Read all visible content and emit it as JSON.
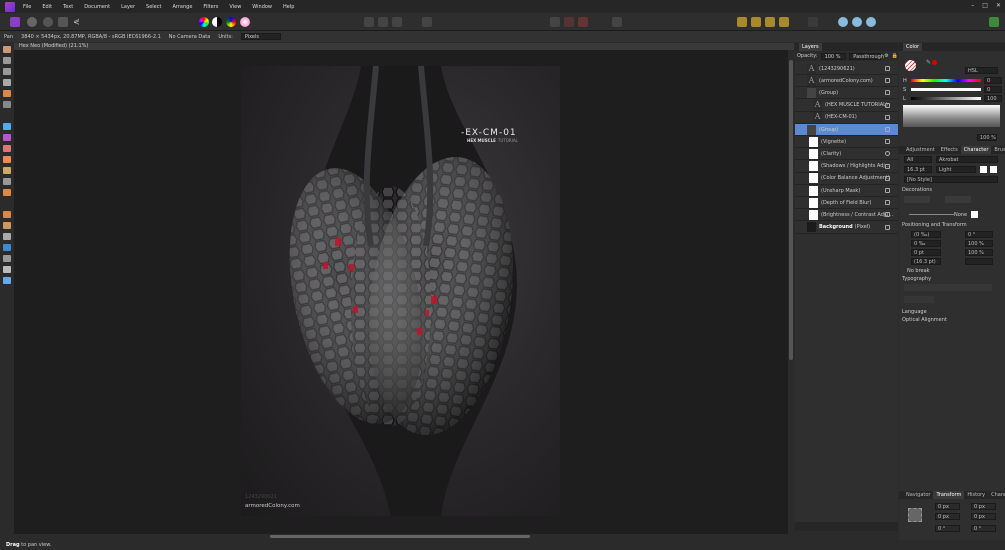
{
  "menu": [
    "File",
    "Edit",
    "Text",
    "Document",
    "Layer",
    "Select",
    "Arrange",
    "Filters",
    "View",
    "Window",
    "Help"
  ],
  "context": {
    "tool": "Pan",
    "info": "3840 × 5434px, 20.87MP, RGBA/8 - sRGB IEC61966-2.1",
    "camera": "No Camera Data",
    "units_label": "Units:",
    "units_value": "Pixels"
  },
  "document_tab": "Hex Neo (Modified) (21.1%)",
  "canvas": {
    "title_art": "-EX-CM-01",
    "subtitle": "HEX MUSCLE",
    "subtitle2": "TUTORIAL",
    "watermark_small": "1243290621",
    "watermark": "armoredColony.com"
  },
  "layers": {
    "tab": "Layers",
    "opacity_label": "Opacity:",
    "opacity": "100 %",
    "blend": "Passthrough",
    "items": [
      {
        "name": "(1243290621)",
        "type": "text"
      },
      {
        "name": "(armoredColony.com)",
        "type": "text"
      },
      {
        "name": "(Group)",
        "type": "group"
      },
      {
        "name": "(HEX MUSCLE TUTORIAL)",
        "type": "text"
      },
      {
        "name": "(HEX-CM-01)",
        "type": "text"
      },
      {
        "name": "(Group)",
        "type": "group",
        "selected": true
      },
      {
        "name": "(Vignette)",
        "type": "adj"
      },
      {
        "name": "(Clarity)",
        "type": "adj"
      },
      {
        "name": "(Shadows / Highlights Adj...",
        "type": "adj"
      },
      {
        "name": "(Color Balance Adjustment)",
        "type": "adj"
      },
      {
        "name": "(Unsharp Mask)",
        "type": "adj"
      },
      {
        "name": "(Depth of Field Blur)",
        "type": "adj"
      },
      {
        "name": "(Brightness / Contrast Adju...",
        "type": "adj"
      },
      {
        "name": "Background",
        "suffix": "(Pixel)",
        "type": "pixel"
      }
    ]
  },
  "color": {
    "tab": "Color",
    "model": "HSL",
    "h": "0",
    "s": "0",
    "l": "100",
    "h_label": "H",
    "s_label": "S",
    "l_label": "L",
    "opacity": "100 %",
    "accent": "#e00000"
  },
  "character": {
    "tabs": [
      "Adjustment",
      "Effects",
      "Character",
      "Brushes"
    ],
    "active": "Character",
    "scope": "All",
    "font": "Akrobat",
    "size": "16.3 pt",
    "weight": "Light",
    "style": "[No Style]",
    "decorations": "Decorations",
    "none_label": "None",
    "positioning": "Positioning and Transform",
    "kerning": "(0 ‰)",
    "tracking": "0 ‰",
    "baseline": "0 pt",
    "leading": "(16.3 pt)",
    "shear": "0 °",
    "hscale": "100 %",
    "vscale": "100 %",
    "no_break": "No break",
    "typography": "Typography",
    "language": "Language",
    "optical": "Optical Alignment"
  },
  "bottom": {
    "tabs": [
      "Navigator",
      "Transform",
      "History",
      "Channels"
    ],
    "active": "Transform",
    "x": "0 px",
    "y": "0 px",
    "w": "0 px",
    "h": "0 px",
    "r": "0 °",
    "s": "0 °"
  },
  "status": {
    "bold": "Drag",
    "rest": " to pan view."
  }
}
